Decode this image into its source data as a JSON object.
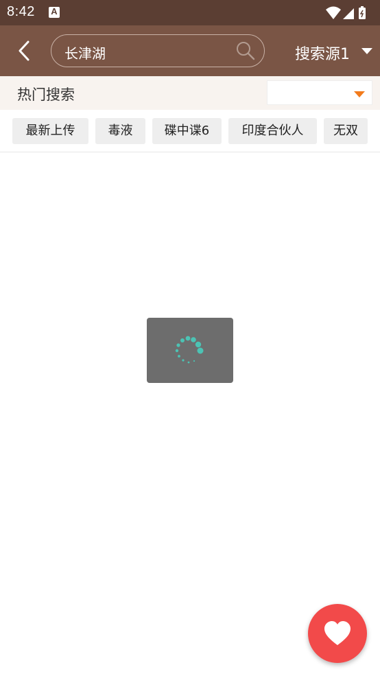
{
  "status_bar": {
    "time": "8:42",
    "icons": [
      "app-notification-icon",
      "wifi-icon",
      "signal-icon",
      "battery-icon"
    ]
  },
  "app_bar": {
    "back_icon": "back-arrow-icon",
    "search_value": "长津湖",
    "search_icon": "search-icon",
    "source_label": "搜索源1"
  },
  "hot_search": {
    "title": "热门搜索",
    "dropdown_value": ""
  },
  "chips": [
    {
      "label": "最新上传"
    },
    {
      "label": "毒液"
    },
    {
      "label": "碟中谍6"
    },
    {
      "label": "印度合伙人"
    },
    {
      "label": "无双"
    }
  ],
  "fab": {
    "icon": "heart-icon"
  },
  "colors": {
    "status_bar": "#5b3e33",
    "app_bar": "#7a5545",
    "accent_orange": "#f27b1c",
    "fab": "#f24a4a",
    "spinner": "#4cc3b4"
  }
}
